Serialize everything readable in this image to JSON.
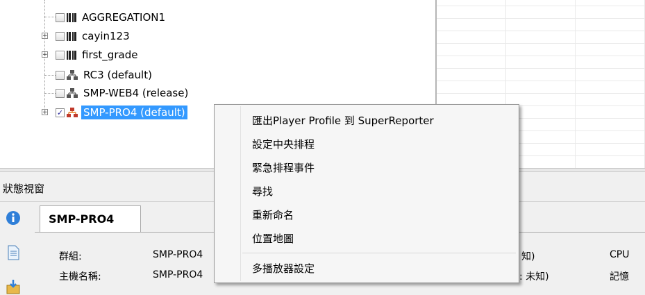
{
  "tree": {
    "items": [
      {
        "label": "AGGREGATION1",
        "icon": "book-icon",
        "expandable": false,
        "checked": false
      },
      {
        "label": "cayin123",
        "icon": "book-icon",
        "expandable": true,
        "checked": false
      },
      {
        "label": "first_grade",
        "icon": "book-icon",
        "expandable": true,
        "checked": false
      },
      {
        "label": "RC3  (default)",
        "icon": "network-icon",
        "expandable": false,
        "checked": false
      },
      {
        "label": "SMP-WEB4  (release)",
        "icon": "network-icon",
        "expandable": false,
        "checked": false
      },
      {
        "label": "SMP-PRO4  (default)",
        "icon": "network-icon",
        "expandable": true,
        "checked": true,
        "selected": true
      }
    ]
  },
  "status_window": {
    "title": "狀態視窗",
    "tab_label": "SMP-PRO4",
    "fields": {
      "group_label": "群組:",
      "group_value": "SMP-PRO4",
      "host_label": "主機名稱:",
      "host_value": "SMP-PRO4",
      "right_a": "知)",
      "right_b": ": 未知)",
      "cpu_label": "CPU",
      "memory_label": "記憶"
    }
  },
  "context_menu": {
    "items": [
      "匯出Player Profile 到 SuperReporter",
      "設定中央排程",
      "緊急排程事件",
      "尋找",
      "重新命名",
      "位置地圖",
      "多播放器設定"
    ]
  },
  "colors": {
    "selection": "#3399ff",
    "info_icon": "#2f7fd8",
    "network_icon": "#c0392b"
  }
}
